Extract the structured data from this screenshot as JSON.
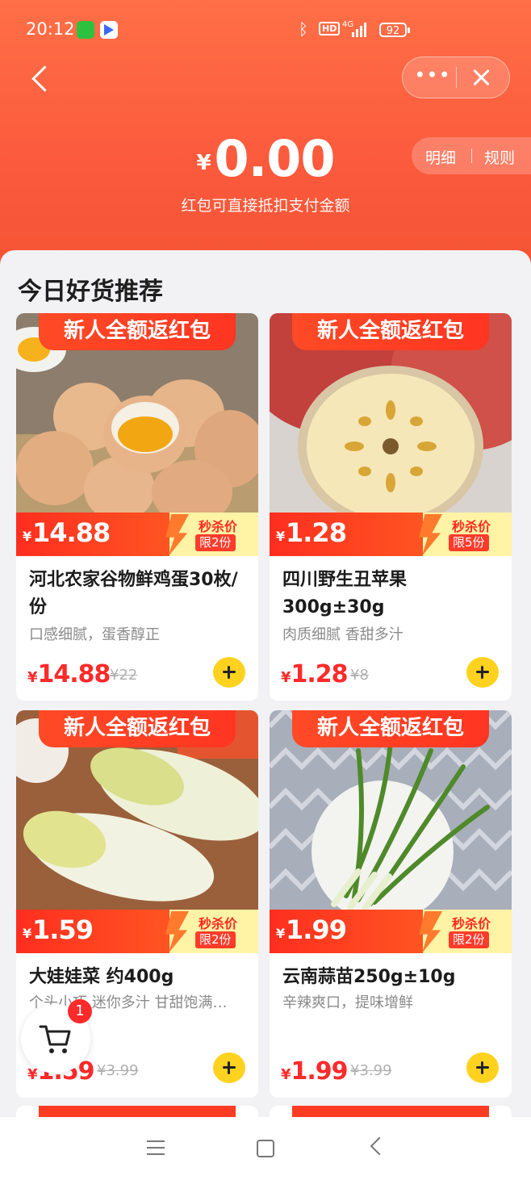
{
  "status_bar": {
    "time": "20:12",
    "network": "4G",
    "battery": "92"
  },
  "header": {
    "currency": "¥",
    "amount": "0.00",
    "subtitle": "红包可直接抵扣支付金额",
    "detail_link": "明细",
    "rules_link": "规则"
  },
  "section": {
    "title": "今日好货推荐"
  },
  "products": [
    {
      "ribbon": "新人全额返红包",
      "price": "14.88",
      "flash_label": "秒杀价",
      "limit": "限2份",
      "name": "河北农家谷物鲜鸡蛋30枚/份",
      "desc": "口感细腻，蛋香醇正",
      "sale_price": "14.88",
      "original_price": "¥22",
      "image": "eggs"
    },
    {
      "ribbon": "新人全额返红包",
      "price": "1.28",
      "flash_label": "秒杀价",
      "limit": "限5份",
      "name": "四川野生丑苹果300g±30g",
      "desc": "肉质细腻 香甜多汁",
      "sale_price": "1.28",
      "original_price": "¥8",
      "image": "apple"
    },
    {
      "ribbon": "新人全额返红包",
      "price": "1.59",
      "flash_label": "秒杀价",
      "limit": "限2份",
      "name": "大娃娃菜 约400g",
      "desc": "个头小巧 迷你多汁 甘甜饱满…",
      "sale_price": "1.59",
      "original_price": "¥3.99",
      "image": "cabbage"
    },
    {
      "ribbon": "新人全额返红包",
      "price": "1.99",
      "flash_label": "秒杀价",
      "limit": "限2份",
      "name": "云南蒜苗250g±10g",
      "desc": "辛辣爽口，提味增鲜",
      "sale_price": "1.99",
      "original_price": "¥3.99",
      "image": "garlic-sprouts"
    }
  ],
  "currency_symbol": "¥",
  "cart": {
    "count": "1"
  },
  "colors": {
    "header": "#fb5a3c",
    "price": "#ff2a2a",
    "add_button": "#ffd21f"
  }
}
